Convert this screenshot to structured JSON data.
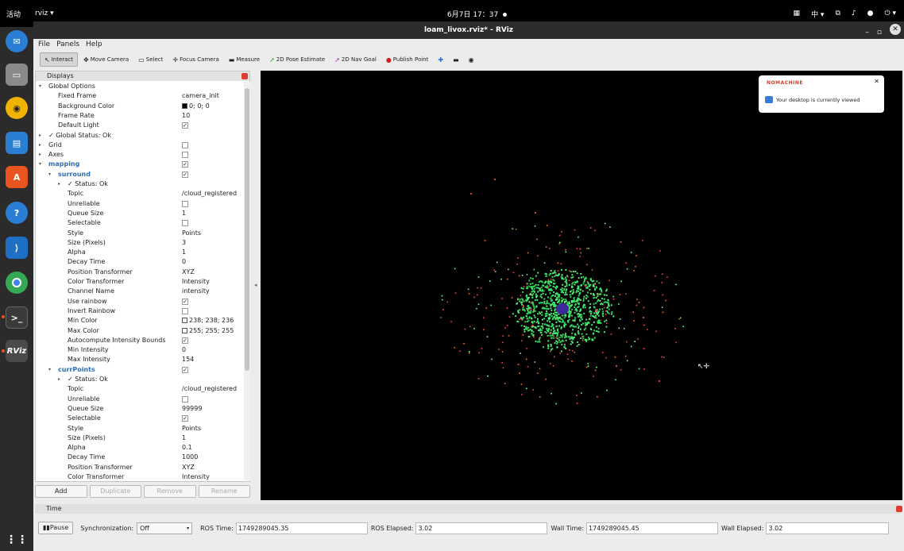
{
  "topbar": {
    "activities": "活动",
    "app_menu": "rviz ▾",
    "datetime": "6月7日 17：37",
    "input_method": "中 ▾"
  },
  "window": {
    "title": "loam_livox.rviz* - RViz"
  },
  "menu": [
    "File",
    "Panels",
    "Help"
  ],
  "toolbar": {
    "interact": "Interact",
    "move_camera": "Move Camera",
    "select": "Select",
    "focus_camera": "Focus Camera",
    "measure": "Measure",
    "pose_estimate": "2D Pose Estimate",
    "nav_goal": "2D Nav Goal",
    "publish_point": "Publish Point"
  },
  "displays": {
    "title": "Displays",
    "rows": [
      {
        "label": "Global Options",
        "value": "",
        "indent": 1,
        "arrow": "▾",
        "icon": "globe"
      },
      {
        "label": "Fixed Frame",
        "value": "camera_init",
        "indent": 2
      },
      {
        "label": "Background Color",
        "value": "0; 0; 0",
        "indent": 2,
        "swatch": "#000000"
      },
      {
        "label": "Frame Rate",
        "value": "10",
        "indent": 2
      },
      {
        "label": "Default Light",
        "value": "",
        "indent": 2,
        "check": "✓"
      },
      {
        "label": "✓ Global Status: Ok",
        "value": "",
        "indent": 1,
        "arrow": "▸"
      },
      {
        "label": "Grid",
        "value": "",
        "indent": 1,
        "arrow": "▸",
        "check": ""
      },
      {
        "label": "Axes",
        "value": "",
        "indent": 1,
        "arrow": "▸",
        "check": ""
      },
      {
        "label": "mapping",
        "value": "",
        "indent": 1,
        "arrow": "▾",
        "check": "✓",
        "blue": true
      },
      {
        "label": "surround",
        "value": "",
        "indent": 2,
        "arrow": "▾",
        "check": "✓",
        "blue": true
      },
      {
        "label": "✓ Status: Ok",
        "value": "",
        "indent": 3,
        "arrow": "▸"
      },
      {
        "label": "Topic",
        "value": "/cloud_registered",
        "indent": 3
      },
      {
        "label": "Unreliable",
        "value": "",
        "indent": 3,
        "check": ""
      },
      {
        "label": "Queue Size",
        "value": "1",
        "indent": 3
      },
      {
        "label": "Selectable",
        "value": "",
        "indent": 3,
        "check": ""
      },
      {
        "label": "Style",
        "value": "Points",
        "indent": 3
      },
      {
        "label": "Size (Pixels)",
        "value": "3",
        "indent": 3
      },
      {
        "label": "Alpha",
        "value": "1",
        "indent": 3
      },
      {
        "label": "Decay Time",
        "value": "0",
        "indent": 3
      },
      {
        "label": "Position Transformer",
        "value": "XYZ",
        "indent": 3
      },
      {
        "label": "Color Transformer",
        "value": "Intensity",
        "indent": 3
      },
      {
        "label": "Channel Name",
        "value": "intensity",
        "indent": 3
      },
      {
        "label": "Use rainbow",
        "value": "",
        "indent": 3,
        "check": "✓"
      },
      {
        "label": "Invert Rainbow",
        "value": "",
        "indent": 3,
        "check": ""
      },
      {
        "label": "Min Color",
        "value": "238; 238; 236",
        "indent": 3,
        "swatch": "#eeeeec"
      },
      {
        "label": "Max Color",
        "value": "255; 255; 255",
        "indent": 3,
        "swatch": "#ffffff"
      },
      {
        "label": "Autocompute Intensity Bounds",
        "value": "",
        "indent": 3,
        "check": "✓"
      },
      {
        "label": "Min Intensity",
        "value": "0",
        "indent": 3
      },
      {
        "label": "Max Intensity",
        "value": "154",
        "indent": 3
      },
      {
        "label": "currPoints",
        "value": "",
        "indent": 2,
        "arrow": "▾",
        "check": "✓",
        "blue": true
      },
      {
        "label": "✓ Status: Ok",
        "value": "",
        "indent": 3,
        "arrow": "▸"
      },
      {
        "label": "Topic",
        "value": "/cloud_registered",
        "indent": 3
      },
      {
        "label": "Unreliable",
        "value": "",
        "indent": 3,
        "check": ""
      },
      {
        "label": "Queue Size",
        "value": "99999",
        "indent": 3
      },
      {
        "label": "Selectable",
        "value": "",
        "indent": 3,
        "check": "✓"
      },
      {
        "label": "Style",
        "value": "Points",
        "indent": 3
      },
      {
        "label": "Size (Pixels)",
        "value": "1",
        "indent": 3
      },
      {
        "label": "Alpha",
        "value": "0.1",
        "indent": 3
      },
      {
        "label": "Decay Time",
        "value": "1000",
        "indent": 3
      },
      {
        "label": "Position Transformer",
        "value": "XYZ",
        "indent": 3
      },
      {
        "label": "Color Transformer",
        "value": "Intensity",
        "indent": 3
      }
    ],
    "buttons": {
      "add": "Add",
      "duplicate": "Duplicate",
      "remove": "Remove",
      "rename": "Rename"
    }
  },
  "notification": {
    "brand": "NOMACHINE",
    "message": "Your desktop is currently viewed"
  },
  "time": {
    "title": "Time",
    "pause": "Pause",
    "sync_label": "Synchronization:",
    "sync_value": "Off",
    "ros_time_label": "ROS Time:",
    "ros_time": "1749289045.35",
    "ros_elapsed_label": "ROS Elapsed:",
    "ros_elapsed": "3.02",
    "wall_time_label": "Wall Time:",
    "wall_time": "1749289045.45",
    "wall_elapsed_label": "Wall Elapsed:",
    "wall_elapsed": "3.02"
  },
  "dock_icons": [
    "thunderbird-icon",
    "files-icon",
    "rhythmbox-icon",
    "writer-icon",
    "software-icon",
    "help-icon",
    "vscode-icon",
    "chrome-icon",
    "terminal-icon",
    "rviz-icon",
    "apps-grid-icon"
  ],
  "dock_labels": {
    "rviz": "RViz"
  }
}
